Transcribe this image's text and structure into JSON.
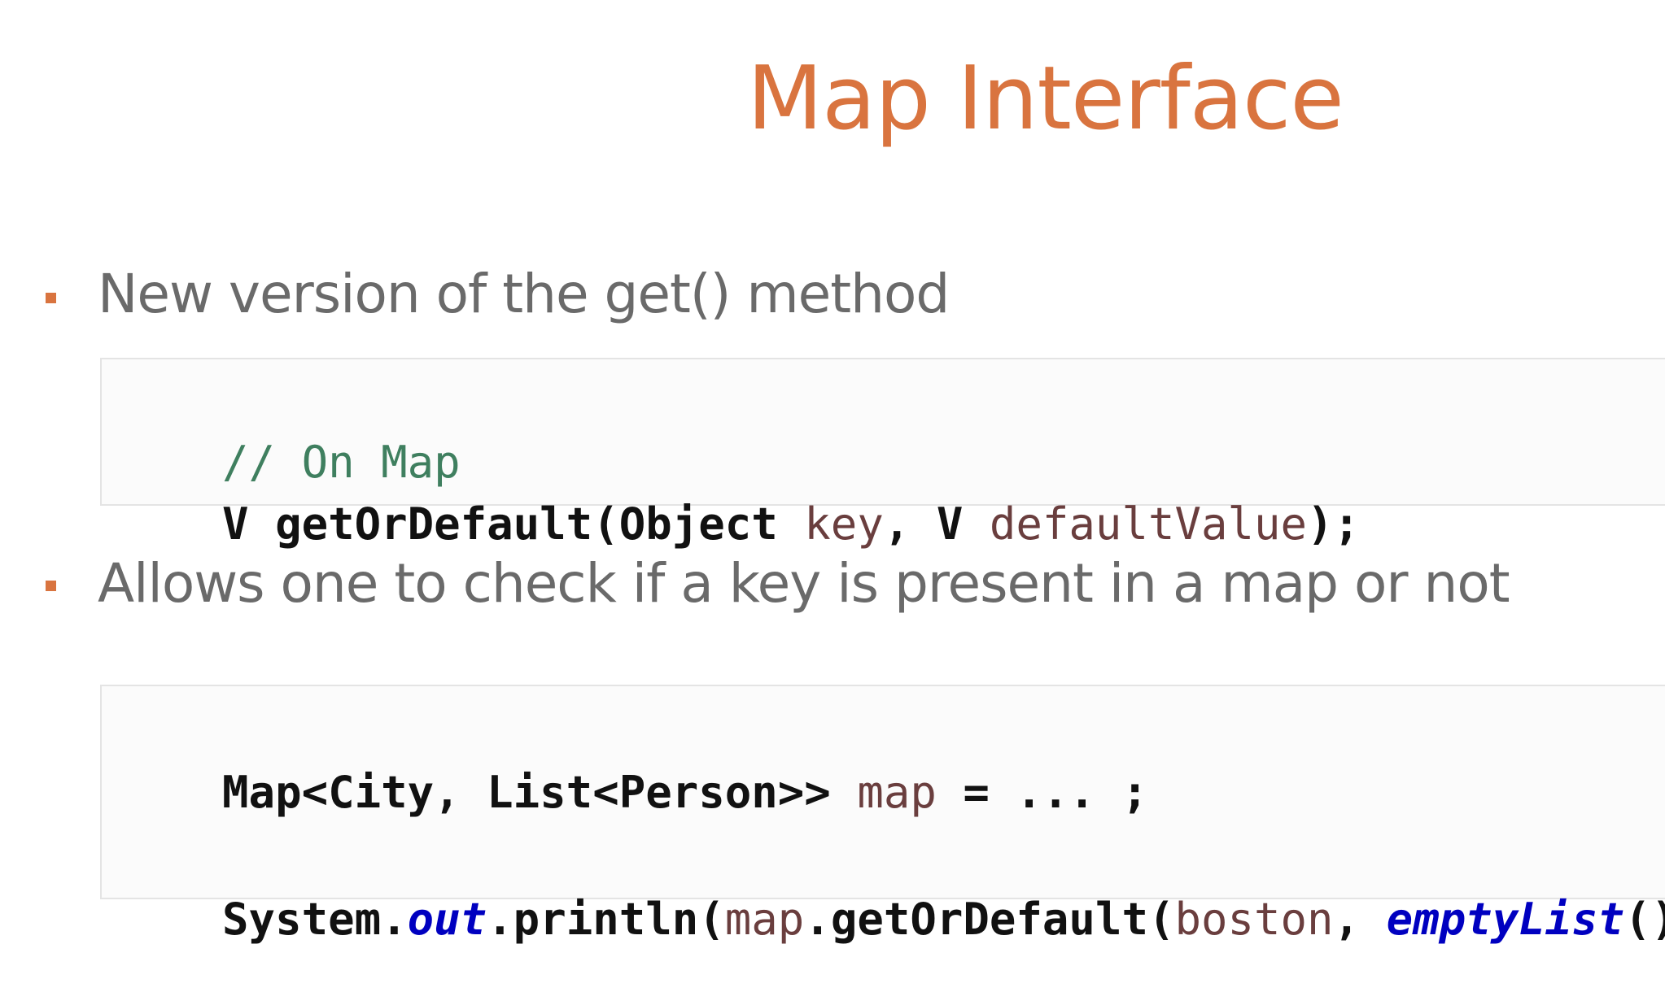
{
  "slide": {
    "title": "Map Interface"
  },
  "bullets": [
    {
      "text": "New version of the get() method"
    },
    {
      "text": "Allows one to check if a key is present in a map or not"
    }
  ],
  "code1": {
    "comment": "// On Map",
    "line2": {
      "part1": "V getOrDefault(Object ",
      "param1": "key",
      "part2": ", V ",
      "param2": "defaultValue",
      "part3": ");"
    }
  },
  "code2": {
    "line1": {
      "part1": "Map<City, List<Person>> ",
      "var": "map",
      "part2": " = ... ;"
    },
    "line2": {
      "part1": "System.",
      "static_field": "out",
      "part2": ".println(",
      "var": "map",
      "part3": ".getOrDefault(",
      "arg": "boston",
      "part4": ", ",
      "static_method": "emptyList",
      "part5": "());"
    }
  },
  "colors": {
    "accent": "#d9743f",
    "body_text": "#6a6a6a",
    "comment": "#3f7f5f",
    "variable": "#6a3e3e",
    "static": "#0000c0"
  }
}
